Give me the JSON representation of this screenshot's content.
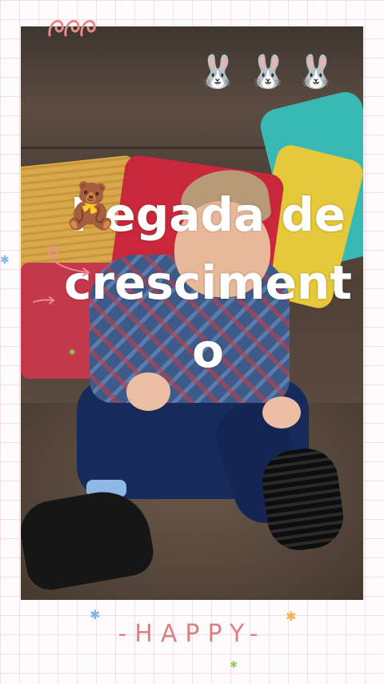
{
  "caption": {
    "text": "Pegada de crescimento",
    "color": "#ffffff"
  },
  "stickers": {
    "top_left": "swirl-doodle",
    "bunnies": [
      "🐰",
      "🐰",
      "🐰"
    ],
    "teddy": "🧸",
    "decor": [
      "heart-doodle",
      "arrow-doodle",
      "star",
      "star",
      "star",
      "star",
      "star"
    ]
  },
  "footer": {
    "text": "-HAPPY-",
    "color": "#e07f7f"
  },
  "colors": {
    "grid": "#e6c8d2",
    "background": "#fdfbfc"
  }
}
